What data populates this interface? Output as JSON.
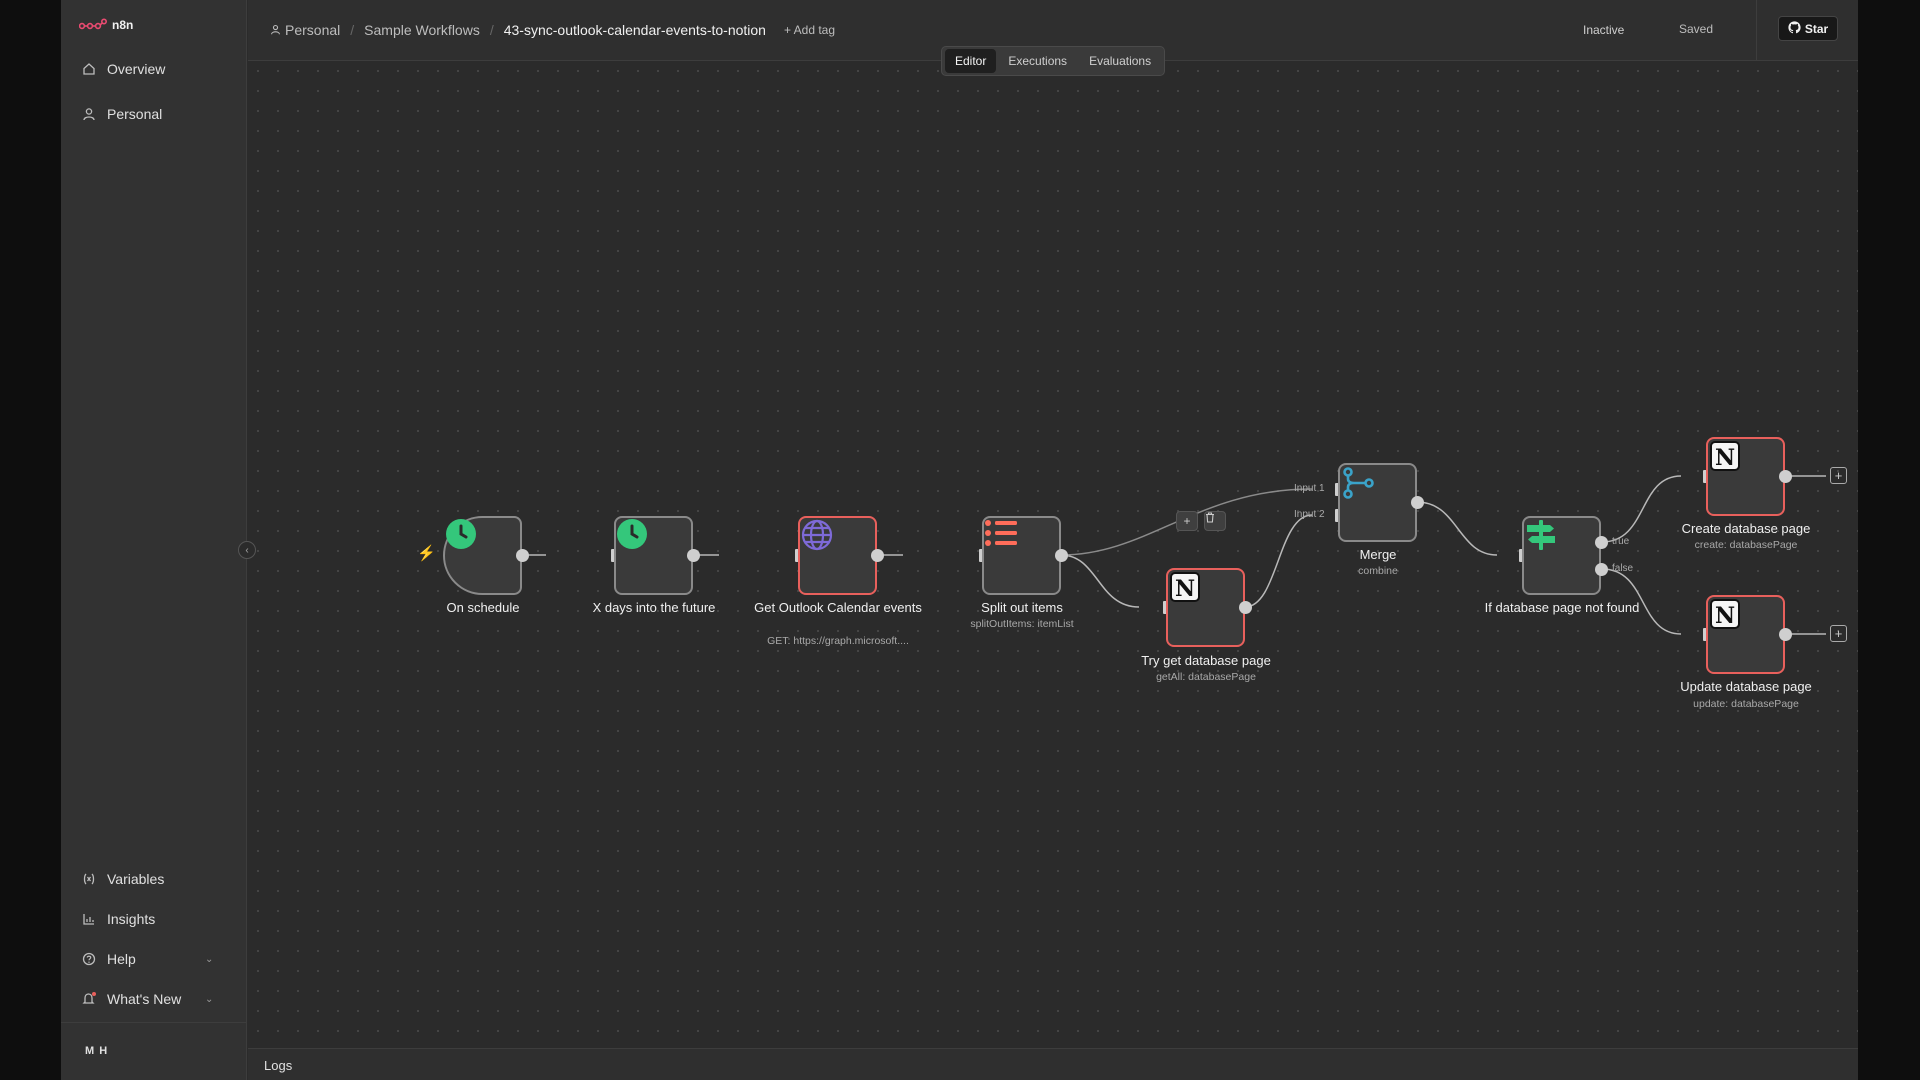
{
  "app": {
    "name": "n8n"
  },
  "sidebar": {
    "top_items": [
      {
        "label": "Overview",
        "icon": "home-icon"
      },
      {
        "label": "Personal",
        "icon": "user-icon"
      }
    ],
    "bottom_items": [
      {
        "label": "Variables",
        "icon": "variables-icon"
      },
      {
        "label": "Insights",
        "icon": "chart-icon"
      },
      {
        "label": "Help",
        "icon": "help-icon"
      },
      {
        "label": "What's New",
        "icon": "bell-icon"
      }
    ],
    "user_initials": "M H"
  },
  "header": {
    "breadcrumb": [
      "Personal",
      "Sample Workflows",
      "43-sync-outlook-calendar-events-to-notion"
    ],
    "add_tag": "+ Add tag",
    "status": "Inactive",
    "save_state": "Saved",
    "star_label": "Star"
  },
  "tabs": [
    {
      "label": "Editor",
      "active": true
    },
    {
      "label": "Executions",
      "active": false
    },
    {
      "label": "Evaluations",
      "active": false
    }
  ],
  "nodes": [
    {
      "name": "On schedule",
      "subtitle": "",
      "icon": "clock-icon"
    },
    {
      "name": "X days into the future",
      "subtitle": "",
      "icon": "clock-icon"
    },
    {
      "name": "Get Outlook Calendar events",
      "subtitle": "GET: https://graph.microsoft....",
      "icon": "globe-icon"
    },
    {
      "name": "Split out items",
      "subtitle": "splitOutItems: itemList",
      "icon": "list-icon"
    },
    {
      "name": "Try get database page",
      "subtitle": "getAll: databasePage",
      "icon": "notion-icon"
    },
    {
      "name": "Merge",
      "subtitle": "combine",
      "icon": "merge-icon"
    },
    {
      "name": "If database page not found",
      "subtitle": "",
      "icon": "if-icon"
    },
    {
      "name": "Create database page",
      "subtitle": "create: databasePage",
      "icon": "notion-icon"
    },
    {
      "name": "Update database page",
      "subtitle": "update: databasePage",
      "icon": "notion-icon"
    }
  ],
  "port_labels": {
    "merge_input1": "Input 1",
    "merge_input2": "Input 2",
    "if_true": "true",
    "if_false": "false"
  },
  "edge_buttons": {
    "add": "+",
    "delete": "🗑"
  },
  "logs": {
    "label": "Logs"
  },
  "colors": {
    "accent_green": "#34c77b",
    "issue_border": "#e8605c",
    "brand": "#ea4b71",
    "merge_blue": "#3aa3c9",
    "list_red": "#ff6d5a",
    "globe_purple": "#7e6ad8"
  }
}
